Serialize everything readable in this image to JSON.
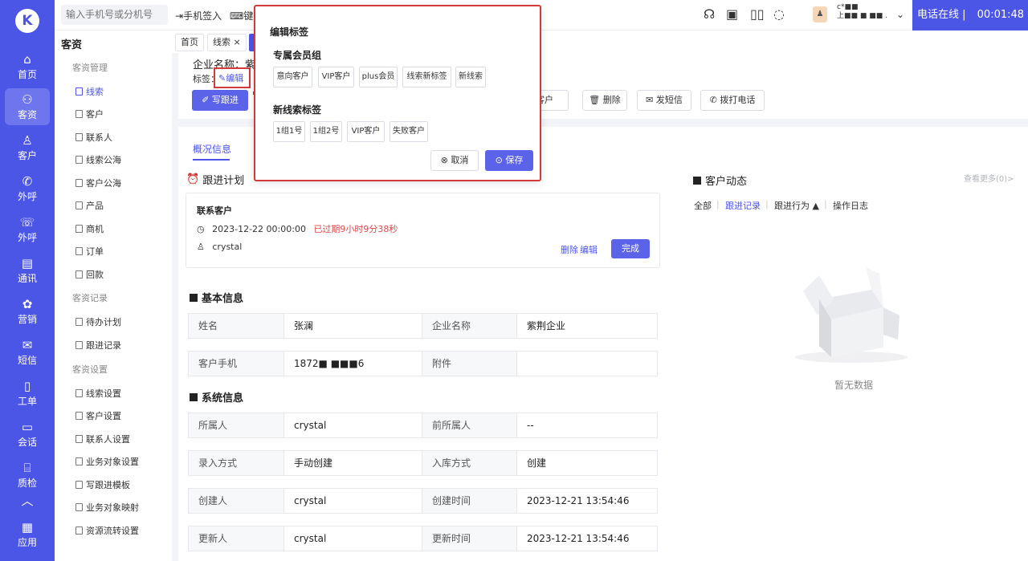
{
  "app": {
    "logo_text": "K"
  },
  "nav": [
    {
      "label": "首页",
      "icon": "home-icon",
      "glyph": "⌂"
    },
    {
      "label": "客资",
      "icon": "users-icon",
      "glyph": "⚇",
      "active": true
    },
    {
      "label": "客户",
      "icon": "person-icon",
      "glyph": "♙"
    },
    {
      "label": "外呼",
      "icon": "phone-out-icon",
      "glyph": "✆"
    },
    {
      "label": "外呼",
      "icon": "phone-call-icon",
      "glyph": "☏"
    },
    {
      "label": "通讯",
      "icon": "contacts-icon",
      "glyph": "▤"
    },
    {
      "label": "营销",
      "icon": "marketing-icon",
      "glyph": "✿"
    },
    {
      "label": "短信",
      "icon": "sms-icon",
      "glyph": "✉"
    },
    {
      "label": "工单",
      "icon": "ticket-icon",
      "glyph": "▯"
    },
    {
      "label": "会话",
      "icon": "chat-icon",
      "glyph": "▭"
    },
    {
      "label": "质检",
      "icon": "inspect-icon",
      "glyph": "⌸"
    },
    {
      "label": "",
      "icon": "collapse-icon",
      "glyph": "︿"
    },
    {
      "label": "应用",
      "icon": "apps-icon",
      "glyph": "▦"
    }
  ],
  "topbar": {
    "search_placeholder": "输入手机号或分机号",
    "sign_in": "手机签入",
    "keyboard": "键盘",
    "user_line1": "c*■■",
    "user_line2": "上■■ ■ ■■ .",
    "phone_status": "电话在线 |",
    "timer": "00:01:48"
  },
  "sidebar": {
    "title": "客资",
    "groups": [
      {
        "label": "客资管理",
        "items": [
          "线索",
          "客户",
          "联系人",
          "线索公海",
          "客户公海",
          "产品",
          "商机",
          "订单",
          "回款"
        ]
      },
      {
        "label": "客资记录",
        "items": [
          "待办计划",
          "跟进记录"
        ]
      },
      {
        "label": "客资设置",
        "items": [
          "线索设置",
          "客户设置",
          "联系人设置",
          "业务对象设置",
          "写跟进模板",
          "业务对象映射",
          "资源流转设置"
        ]
      }
    ],
    "active_item": "线索"
  },
  "tabs": [
    {
      "label": "首页"
    },
    {
      "label": "线索 ×"
    },
    {
      "label": "",
      "active": true
    }
  ],
  "header": {
    "company": "企业名称：紫荆",
    "tag_label": "标签：",
    "edit_label": "编辑",
    "actions": {
      "write_followup": "写跟进",
      "to_customer": "转客户",
      "delete": "删除",
      "send_sms": "发短信",
      "call": "拨打电话"
    }
  },
  "main": {
    "subtab": "概况信息",
    "followup_plan": {
      "title": "跟进计划",
      "item_title": "联系客户",
      "datetime": "2023-12-22 00:00:00",
      "overdue": "已过期9小时9分38秒",
      "owner": "crystal",
      "delete": "删除",
      "edit": "编辑",
      "done": "完成"
    },
    "basic_info": {
      "title": "基本信息",
      "rows": [
        [
          "姓名",
          "张澜",
          "企业名称",
          "紫荆企业"
        ],
        [
          "客户手机",
          "1872■ ■■■6",
          "附件",
          ""
        ]
      ]
    },
    "system_info": {
      "title": "系统信息",
      "rows": [
        [
          "所属人",
          "crystal",
          "前所属人",
          "--"
        ],
        [
          "录入方式",
          "手动创建",
          "入库方式",
          "创建"
        ],
        [
          "创建人",
          "crystal",
          "创建时间",
          "2023-12-21 13:54:46"
        ],
        [
          "更新人",
          "crystal",
          "更新时间",
          "2023-12-21 13:54:46"
        ]
      ]
    }
  },
  "right": {
    "title": "客户动态",
    "see_more": "查看更多(0)>",
    "filters": [
      "全部",
      "跟进记录",
      "跟进行为 ▲",
      "操作日志"
    ],
    "active_filter": "跟进记录",
    "empty": "暂无数据"
  },
  "popover": {
    "title": "编辑标签",
    "groups": [
      {
        "label": "专属会员组",
        "tags": [
          "意向客户",
          "VIP客户",
          "plus会员",
          "线索新标签",
          "新线索"
        ]
      },
      {
        "label": "新线索标签",
        "tags": [
          "1组1号",
          "1组2号",
          "VIP客户",
          "失败客户"
        ]
      }
    ],
    "cancel": "取消",
    "save": "保存"
  }
}
